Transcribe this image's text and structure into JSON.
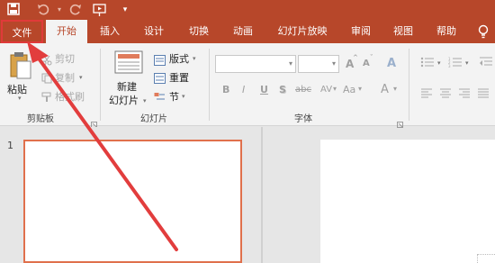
{
  "ribbon_tabs": [
    "文件",
    "开始",
    "插入",
    "设计",
    "切换",
    "动画",
    "幻灯片放映",
    "审阅",
    "视图",
    "帮助"
  ],
  "active_tab": "开始",
  "quick_access": [
    "save-icon",
    "undo-icon",
    "redo-icon",
    "present-from-start-icon",
    "customize-dropdown-icon"
  ],
  "clipboard": {
    "paste": "粘贴",
    "cut": "剪切",
    "copy": "复制",
    "format_painter": "格式刷",
    "group_label": "剪贴板"
  },
  "slides": {
    "new_slide": "新建",
    "new_slide_2": "幻灯片",
    "layout": "版式",
    "reset": "重置",
    "section": "节",
    "group_label": "幻灯片"
  },
  "font": {
    "grow": "A",
    "shrink": "A",
    "clear": "A",
    "bold": "B",
    "italic": "I",
    "underline": "U",
    "shadow": "S",
    "strike": "abc",
    "spacing": "AV",
    "case": "Aa",
    "color": "A",
    "group_label": "字体"
  },
  "slide_thumbnail_number": "1",
  "colors": {
    "accent": "#b7472a",
    "ribbon": "#f3f3f3",
    "highlight": "#e03a3a"
  }
}
